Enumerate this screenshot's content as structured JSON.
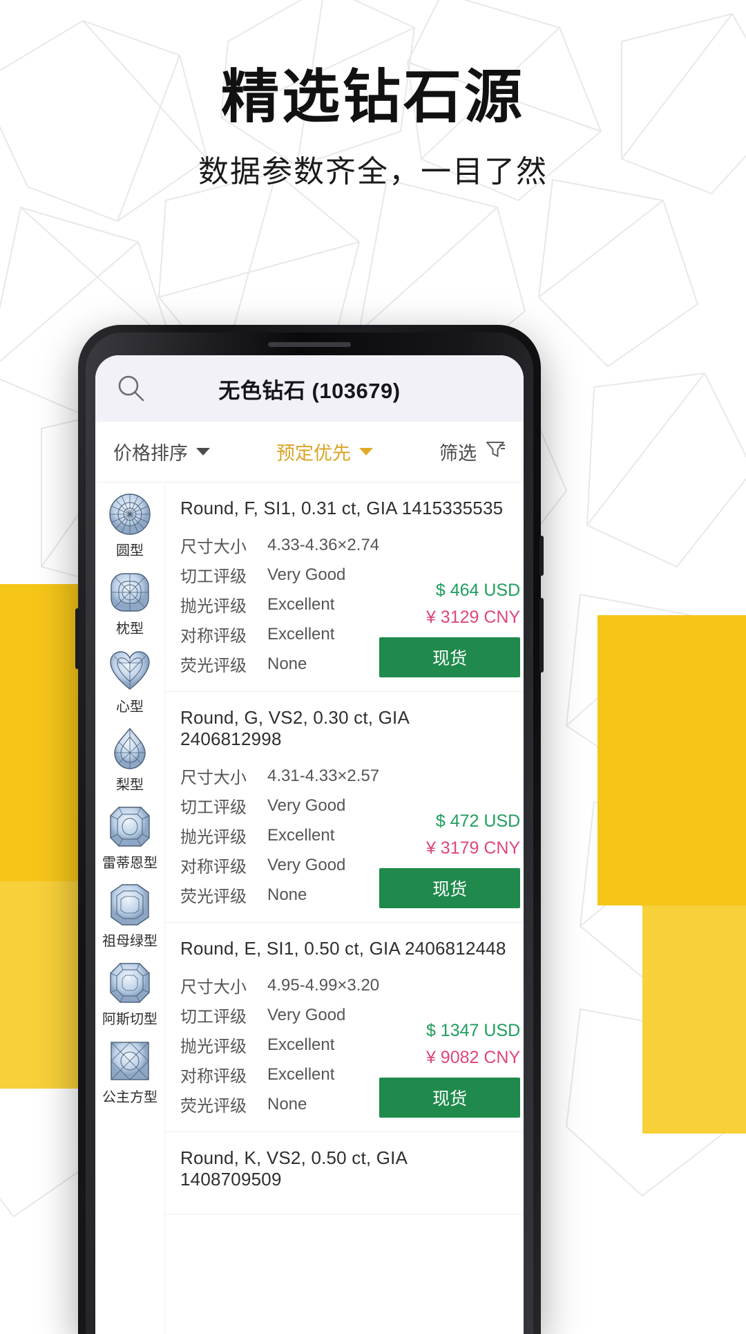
{
  "promo": {
    "headline": "精选钻石源",
    "subheadline": "数据参数齐全，一目了然"
  },
  "colors": {
    "accent_yellow": "#f5c518",
    "gold_text": "#d9a425",
    "price_usd_green": "#1e9d5c",
    "price_cny_pink": "#e0457b",
    "stock_button_green": "#1f8a4c",
    "header_bg": "#f1f1f7"
  },
  "app": {
    "header": {
      "search_icon": "search-icon",
      "title": "无色钻石 (103679)"
    },
    "filter_bar": {
      "sort_label": "价格排序",
      "priority_label": "预定优先",
      "more_label": "筛选",
      "caret_icon": "chevron-down-icon",
      "funnel_icon": "filter-funnel-icon"
    },
    "shapes": [
      {
        "label": "圆型",
        "icon": "round-diamond-icon"
      },
      {
        "label": "枕型",
        "icon": "cushion-diamond-icon"
      },
      {
        "label": "心型",
        "icon": "heart-diamond-icon"
      },
      {
        "label": "梨型",
        "icon": "pear-diamond-icon"
      },
      {
        "label": "雷蒂恩型",
        "icon": "radiant-diamond-icon"
      },
      {
        "label": "祖母绿型",
        "icon": "emerald-diamond-icon"
      },
      {
        "label": "阿斯切型",
        "icon": "asscher-diamond-icon"
      },
      {
        "label": "公主方型",
        "icon": "princess-diamond-icon"
      }
    ],
    "spec_labels": {
      "size": "尺寸大小",
      "cut": "切工评级",
      "polish": "抛光评级",
      "symmetry": "对称评级",
      "fluorescence": "荧光评级"
    },
    "stock_label": "现货",
    "listings": [
      {
        "title": "Round, F, SI1, 0.31 ct, GIA 1415335535",
        "size": "4.33-4.36×2.74",
        "cut": "Very Good",
        "polish": "Excellent",
        "symmetry": "Excellent",
        "fluorescence": "None",
        "price_usd": "$ 464 USD",
        "price_cny": "¥ 3129 CNY",
        "stock": "现货"
      },
      {
        "title": "Round, G, VS2, 0.30 ct, GIA 2406812998",
        "size": "4.31-4.33×2.57",
        "cut": "Very Good",
        "polish": "Excellent",
        "symmetry": "Very Good",
        "fluorescence": "None",
        "price_usd": "$ 472 USD",
        "price_cny": "¥ 3179 CNY",
        "stock": "现货"
      },
      {
        "title": "Round, E, SI1, 0.50 ct, GIA 2406812448",
        "size": "4.95-4.99×3.20",
        "cut": "Very Good",
        "polish": "Excellent",
        "symmetry": "Excellent",
        "fluorescence": "None",
        "price_usd": "$ 1347 USD",
        "price_cny": "¥ 9082 CNY",
        "stock": "现货"
      },
      {
        "title": "Round, K, VS2, 0.50 ct, GIA 1408709509",
        "size": "",
        "cut": "",
        "polish": "",
        "symmetry": "",
        "fluorescence": "",
        "price_usd": "",
        "price_cny": "",
        "stock": ""
      }
    ]
  }
}
